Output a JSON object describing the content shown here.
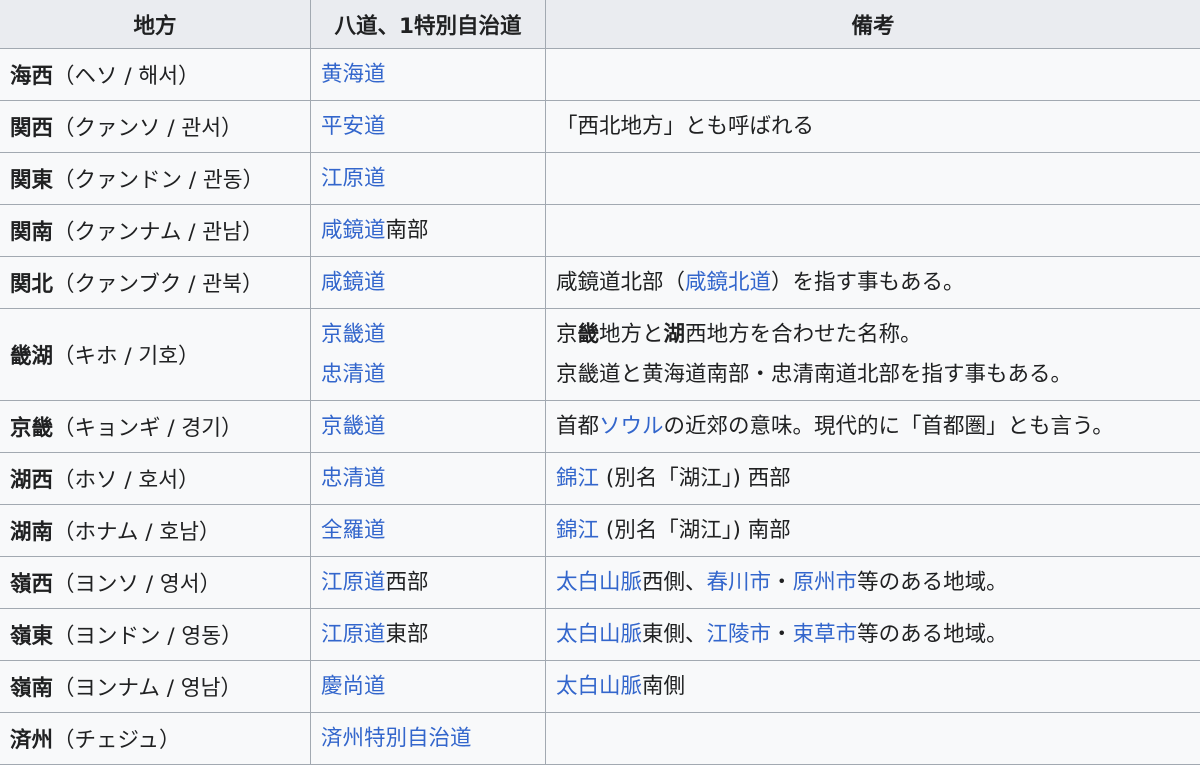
{
  "headers": [
    "地方",
    "八道、1特別自治道",
    "備考"
  ],
  "rows": [
    {
      "name": "海西",
      "reading": "（ヘソ / 해서）",
      "province": [
        [
          {
            "t": "黄海道",
            "link": true
          }
        ]
      ],
      "note": []
    },
    {
      "name": "関西",
      "reading": "（クァンソ / 관서）",
      "province": [
        [
          {
            "t": "平安道",
            "link": true
          }
        ]
      ],
      "note": [
        [
          {
            "t": "「西北地方」とも呼ばれる"
          }
        ]
      ]
    },
    {
      "name": "関東",
      "reading": "（クァンドン / 관동）",
      "province": [
        [
          {
            "t": "江原道",
            "link": true
          }
        ]
      ],
      "note": []
    },
    {
      "name": "関南",
      "reading": "（クァンナム / 관남）",
      "province": [
        [
          {
            "t": "咸鏡道",
            "link": true
          },
          {
            "t": "南部"
          }
        ]
      ],
      "note": []
    },
    {
      "name": "関北",
      "reading": "（クァンブク / 관북）",
      "province": [
        [
          {
            "t": "咸鏡道",
            "link": true
          }
        ]
      ],
      "note": [
        [
          {
            "t": "咸鏡道北部（"
          },
          {
            "t": "咸鏡北道",
            "link": true
          },
          {
            "t": "）を指す事もある。"
          }
        ]
      ]
    },
    {
      "name": "畿湖",
      "reading": "（キホ / 기호）",
      "province": [
        [
          {
            "t": "京畿道",
            "link": true
          }
        ],
        [
          {
            "t": "忠清道",
            "link": true
          }
        ]
      ],
      "note": [
        [
          {
            "t": "京"
          },
          {
            "t": "畿",
            "bold": true
          },
          {
            "t": "地方と"
          },
          {
            "t": "湖",
            "bold": true
          },
          {
            "t": "西地方を合わせた名称。"
          }
        ],
        [
          {
            "t": "京畿道と黄海道南部・忠清南道北部を指す事もある。"
          }
        ]
      ]
    },
    {
      "name": "京畿",
      "reading": "（キョンギ / 경기）",
      "province": [
        [
          {
            "t": "京畿道",
            "link": true
          }
        ]
      ],
      "note": [
        [
          {
            "t": "首都"
          },
          {
            "t": "ソウル",
            "link": true
          },
          {
            "t": "の近郊の意味。現代的に「首都圏」とも言う。"
          }
        ]
      ]
    },
    {
      "name": "湖西",
      "reading": "（ホソ / 호서）",
      "province": [
        [
          {
            "t": "忠清道",
            "link": true
          }
        ]
      ],
      "note": [
        [
          {
            "t": "錦江",
            "link": true
          },
          {
            "t": " (別名「湖江」) 西部"
          }
        ]
      ]
    },
    {
      "name": "湖南",
      "reading": "（ホナム / 호남）",
      "province": [
        [
          {
            "t": "全羅道",
            "link": true
          }
        ]
      ],
      "note": [
        [
          {
            "t": "錦江",
            "link": true
          },
          {
            "t": " (別名「湖江」) 南部"
          }
        ]
      ]
    },
    {
      "name": "嶺西",
      "reading": "（ヨンソ / 영서）",
      "province": [
        [
          {
            "t": "江原道",
            "link": true
          },
          {
            "t": "西部"
          }
        ]
      ],
      "note": [
        [
          {
            "t": "太白山脈",
            "link": true
          },
          {
            "t": "西側、"
          },
          {
            "t": "春川市",
            "link": true
          },
          {
            "t": "・"
          },
          {
            "t": "原州市",
            "link": true
          },
          {
            "t": "等のある地域。"
          }
        ]
      ]
    },
    {
      "name": "嶺東",
      "reading": "（ヨンドン / 영동）",
      "province": [
        [
          {
            "t": "江原道",
            "link": true
          },
          {
            "t": "東部"
          }
        ]
      ],
      "note": [
        [
          {
            "t": "太白山脈",
            "link": true
          },
          {
            "t": "東側、"
          },
          {
            "t": "江陵市",
            "link": true
          },
          {
            "t": "・"
          },
          {
            "t": "束草市",
            "link": true
          },
          {
            "t": "等のある地域。"
          }
        ]
      ]
    },
    {
      "name": "嶺南",
      "reading": "（ヨンナム / 영남）",
      "province": [
        [
          {
            "t": "慶尚道",
            "link": true
          }
        ]
      ],
      "note": [
        [
          {
            "t": "太白山脈",
            "link": true
          },
          {
            "t": "南側"
          }
        ]
      ]
    },
    {
      "name": "済州",
      "reading": "（チェジュ）",
      "province": [
        [
          {
            "t": "済州特別自治道",
            "link": true
          }
        ]
      ],
      "note": []
    }
  ]
}
